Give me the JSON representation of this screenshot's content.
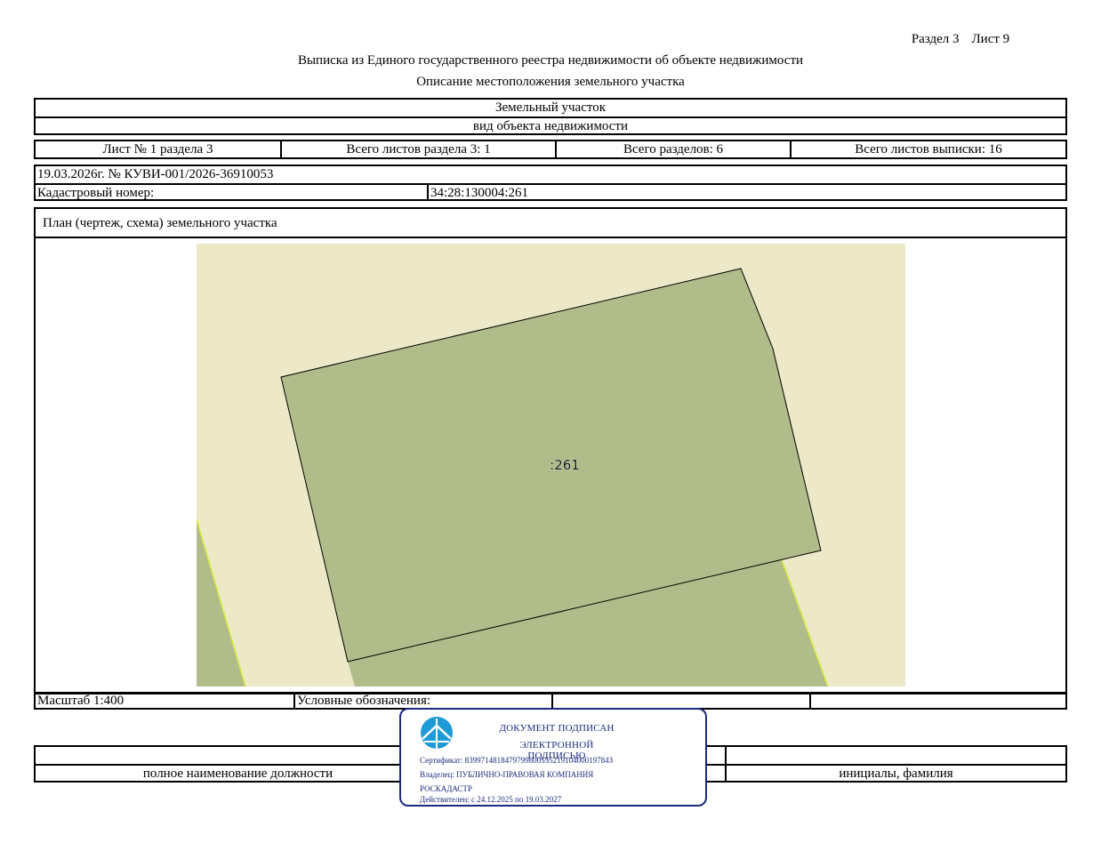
{
  "header": {
    "section": "Раздел 3",
    "sheet": "Лист 9",
    "title": "Выписка из Единого государственного реестра недвижимости об объекте недвижимости",
    "subtitle": "Описание местоположения земельного участка"
  },
  "object": {
    "type_value": "Земельный участок",
    "type_caption": "вид объекта недвижимости"
  },
  "sheets_row": {
    "sheet_of_section": "Лист № 1 раздела 3",
    "total_section_sheets": "Всего листов раздела 3: 1",
    "total_sections": "Всего разделов: 6",
    "total_extract_sheets": "Всего листов выписки: 16"
  },
  "record": {
    "date_number": "19.03.2026г. № КУВИ-001/2026-36910053",
    "cadastral_label": "Кадастровый номер:",
    "cadastral_value": "34:28:130004:261"
  },
  "plan": {
    "title": "План (чертеж, схема) земельного участка",
    "parcel_label": ":261",
    "colors": {
      "background": "#ede8c8",
      "parcel": "#b0bd8b",
      "boundary": "#000000",
      "edge_highlight": "#d7ec3a"
    }
  },
  "legend_row": {
    "scale": "Масштаб 1:400",
    "legend_label": "Условные обозначения:"
  },
  "signature": {
    "position_caption": "полное наименование должности",
    "name_caption": "инициалы, фамилия"
  },
  "stamp": {
    "line1": "ДОКУМЕНТ ПОДПИСАН",
    "line2": "ЭЛЕКТРОННОЙ ПОДПИСЬЮ",
    "certificate": "Сертификат: 839971481847979980055521910400019784З",
    "owner1": "Владелец: ПУБЛИЧНО-ПРАВОВАЯ КОМПАНИЯ",
    "owner2": "РОСКАДАСТР",
    "valid": "Действителен: с 24.12.2025 по 19.03.2027",
    "color": "#1c2a7c",
    "logo_color": "#1e9ad6"
  }
}
